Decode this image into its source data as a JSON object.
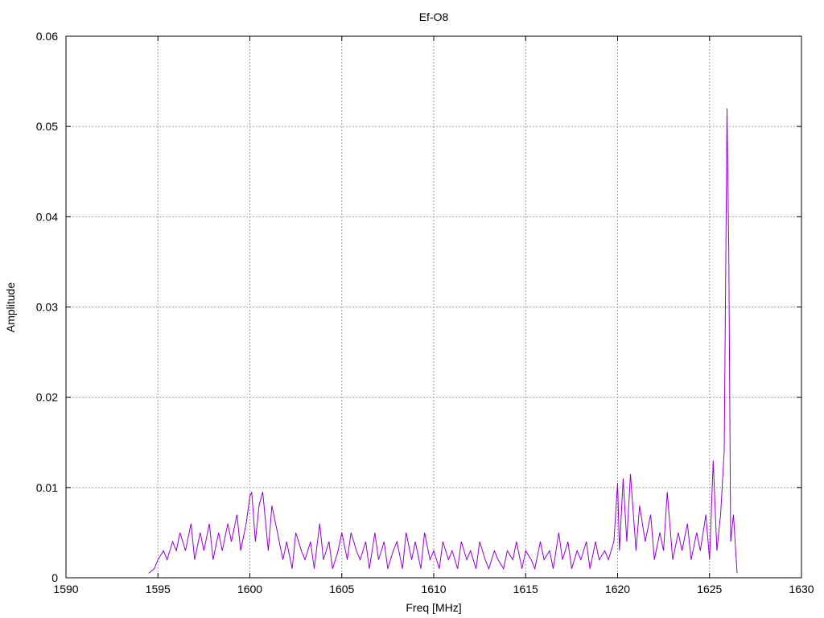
{
  "chart_data": {
    "type": "line",
    "title": "Ef-O8",
    "xlabel": "Freq [MHz]",
    "ylabel": "Amplitude",
    "xlim": [
      1590,
      1630
    ],
    "ylim": [
      0,
      0.06
    ],
    "xticks": [
      1590,
      1595,
      1600,
      1605,
      1610,
      1615,
      1620,
      1625,
      1630
    ],
    "xtick_labels": [
      "1590",
      "1595",
      "1600",
      "1605",
      "1610",
      "1615",
      "1620",
      "1625",
      "1630"
    ],
    "yticks": [
      0,
      0.01,
      0.02,
      0.03,
      0.04,
      0.05,
      0.06
    ],
    "ytick_labels": [
      "0",
      "0.01",
      "0.02",
      "0.03",
      "0.04",
      "0.05",
      "0.06"
    ],
    "grid": true,
    "line_color": "#9400d3",
    "series": [
      {
        "x": [
          1594.5,
          1594.8,
          1595.0,
          1595.3,
          1595.5,
          1595.8,
          1596.0,
          1596.2,
          1596.5,
          1596.8,
          1597.0,
          1597.3,
          1597.5,
          1597.8,
          1598.0,
          1598.3,
          1598.5,
          1598.8,
          1599.0,
          1599.3,
          1599.5,
          1599.8,
          1600.0,
          1600.1,
          1600.3,
          1600.5,
          1600.7,
          1601.0,
          1601.2,
          1601.5,
          1601.8,
          1602.0,
          1602.3,
          1602.5,
          1602.8,
          1603.0,
          1603.3,
          1603.5,
          1603.8,
          1604.0,
          1604.3,
          1604.5,
          1604.8,
          1605.0,
          1605.3,
          1605.5,
          1605.8,
          1606.0,
          1606.3,
          1606.5,
          1606.8,
          1607.0,
          1607.3,
          1607.5,
          1607.8,
          1608.0,
          1608.3,
          1608.5,
          1608.8,
          1609.0,
          1609.3,
          1609.5,
          1609.8,
          1610.0,
          1610.3,
          1610.5,
          1610.8,
          1611.0,
          1611.3,
          1611.5,
          1611.8,
          1612.0,
          1612.3,
          1612.5,
          1612.8,
          1613.0,
          1613.3,
          1613.5,
          1613.8,
          1614.0,
          1614.3,
          1614.5,
          1614.8,
          1615.0,
          1615.3,
          1615.5,
          1615.8,
          1616.0,
          1616.3,
          1616.5,
          1616.8,
          1617.0,
          1617.3,
          1617.5,
          1617.8,
          1618.0,
          1618.3,
          1618.5,
          1618.8,
          1619.0,
          1619.3,
          1619.5,
          1619.8,
          1620.0,
          1620.1,
          1620.3,
          1620.5,
          1620.7,
          1621.0,
          1621.2,
          1621.5,
          1621.8,
          1622.0,
          1622.3,
          1622.5,
          1622.7,
          1623.0,
          1623.3,
          1623.5,
          1623.8,
          1624.0,
          1624.3,
          1624.5,
          1624.8,
          1625.0,
          1625.2,
          1625.4,
          1625.6,
          1625.8,
          1625.95,
          1626.05,
          1626.15,
          1626.3,
          1626.5
        ],
        "y": [
          0.0005,
          0.001,
          0.002,
          0.003,
          0.002,
          0.004,
          0.003,
          0.005,
          0.003,
          0.006,
          0.002,
          0.005,
          0.003,
          0.006,
          0.002,
          0.005,
          0.003,
          0.006,
          0.004,
          0.007,
          0.003,
          0.006,
          0.009,
          0.0095,
          0.004,
          0.008,
          0.0095,
          0.003,
          0.008,
          0.005,
          0.002,
          0.004,
          0.001,
          0.005,
          0.003,
          0.002,
          0.004,
          0.001,
          0.006,
          0.002,
          0.004,
          0.001,
          0.003,
          0.005,
          0.002,
          0.005,
          0.003,
          0.002,
          0.004,
          0.001,
          0.005,
          0.002,
          0.004,
          0.001,
          0.003,
          0.004,
          0.001,
          0.005,
          0.002,
          0.004,
          0.001,
          0.005,
          0.002,
          0.003,
          0.001,
          0.004,
          0.002,
          0.003,
          0.001,
          0.004,
          0.002,
          0.003,
          0.001,
          0.004,
          0.002,
          0.001,
          0.003,
          0.002,
          0.001,
          0.003,
          0.002,
          0.004,
          0.001,
          0.003,
          0.002,
          0.001,
          0.004,
          0.002,
          0.003,
          0.001,
          0.005,
          0.002,
          0.004,
          0.001,
          0.003,
          0.002,
          0.004,
          0.001,
          0.004,
          0.002,
          0.003,
          0.002,
          0.004,
          0.0105,
          0.003,
          0.011,
          0.004,
          0.0115,
          0.003,
          0.008,
          0.004,
          0.007,
          0.002,
          0.005,
          0.003,
          0.0095,
          0.002,
          0.005,
          0.003,
          0.006,
          0.002,
          0.005,
          0.003,
          0.007,
          0.002,
          0.013,
          0.003,
          0.007,
          0.014,
          0.052,
          0.036,
          0.004,
          0.007,
          0.0005
        ]
      }
    ]
  }
}
